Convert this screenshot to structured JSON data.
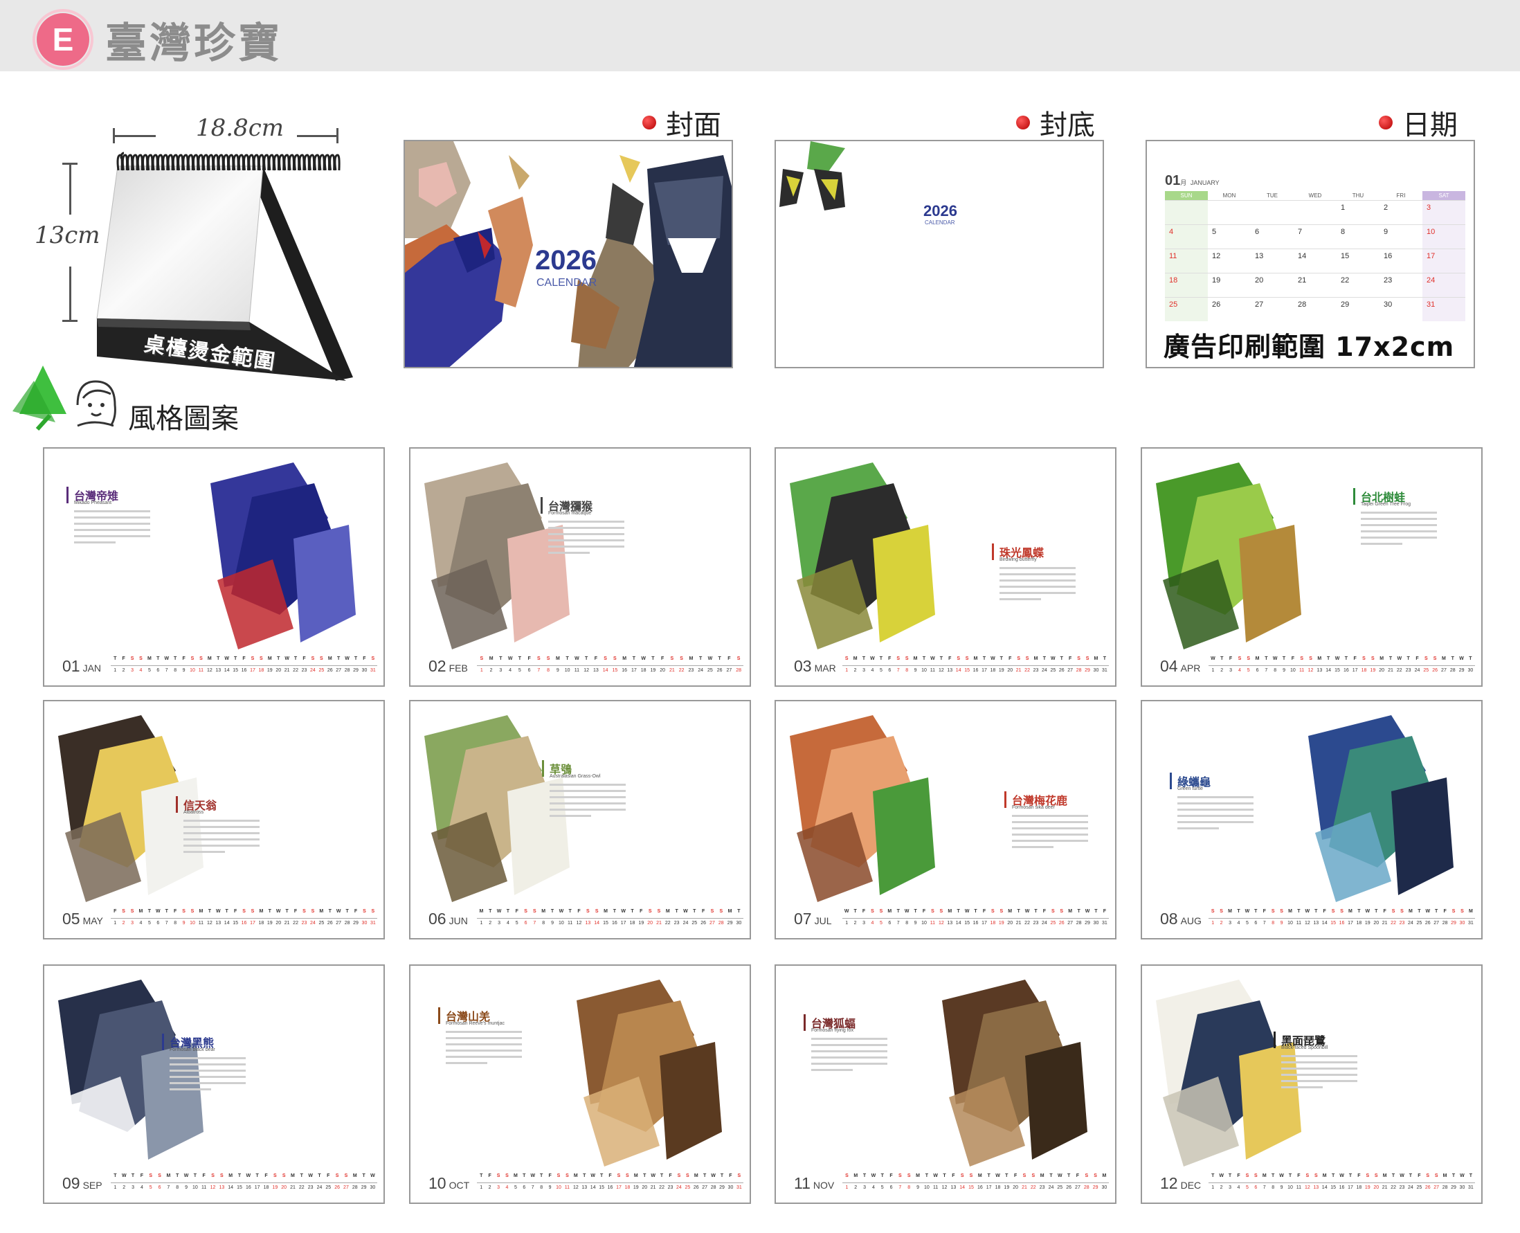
{
  "header": {
    "badge": "E",
    "title": "臺灣珍寶"
  },
  "product": {
    "width_label": "18.8cm",
    "height_label": "13cm",
    "hot_stamp_label": "桌檯燙金範圍",
    "style_label": "風格圖案"
  },
  "sections": {
    "cover": "封面",
    "back": "封底",
    "date": "日期"
  },
  "cover": {
    "year": "2026",
    "calendar": "CALENDAR"
  },
  "back": {
    "year": "2026",
    "calendar": "CALENDAR"
  },
  "date_sample": {
    "month_num": "01",
    "month_zh": "月",
    "month_en": "JANUARY",
    "weekdays": [
      "SUN",
      "MON",
      "TUE",
      "WED",
      "THU",
      "FRI",
      "SAT"
    ],
    "ad_area": "廣告印刷範圍 17x2cm"
  },
  "months": [
    {
      "num": "01",
      "abbr": "JAN",
      "zh": "台灣帝雉",
      "en": "Mikado Pheasant",
      "color": "#5a2d7a"
    },
    {
      "num": "02",
      "abbr": "FEB",
      "zh": "台灣獼猴",
      "en": "Formosan macaque",
      "color": "#444444"
    },
    {
      "num": "03",
      "abbr": "MAR",
      "zh": "珠光鳳蝶",
      "en": "Birdwing butterfly",
      "color": "#c0392b"
    },
    {
      "num": "04",
      "abbr": "APR",
      "zh": "台北樹蛙",
      "en": "Taipei Green Tree Frog",
      "color": "#2e8b3a"
    },
    {
      "num": "05",
      "abbr": "MAY",
      "zh": "信天翁",
      "en": "Albatross",
      "color": "#a0302a"
    },
    {
      "num": "06",
      "abbr": "JUN",
      "zh": "草鴞",
      "en": "Australasian Grass-Owl",
      "color": "#6b8f3a"
    },
    {
      "num": "07",
      "abbr": "JUL",
      "zh": "台灣梅花鹿",
      "en": "Formosan sika deer",
      "color": "#c0392b"
    },
    {
      "num": "08",
      "abbr": "AUG",
      "zh": "綠蠵龜",
      "en": "Green turtle",
      "color": "#2c4a8f"
    },
    {
      "num": "09",
      "abbr": "SEP",
      "zh": "台灣黑熊",
      "en": "Formosan black bear",
      "color": "#2c3a8f"
    },
    {
      "num": "10",
      "abbr": "OCT",
      "zh": "台灣山羌",
      "en": "Formosan Reeve's muntjac",
      "color": "#8b4a1a"
    },
    {
      "num": "11",
      "abbr": "NOV",
      "zh": "台灣狐蝠",
      "en": "Formosan flying fox",
      "color": "#7a2a2a"
    },
    {
      "num": "12",
      "abbr": "DEC",
      "zh": "黑面琵鷺",
      "en": "Black-faced Spoonbill",
      "color": "#222222"
    }
  ]
}
